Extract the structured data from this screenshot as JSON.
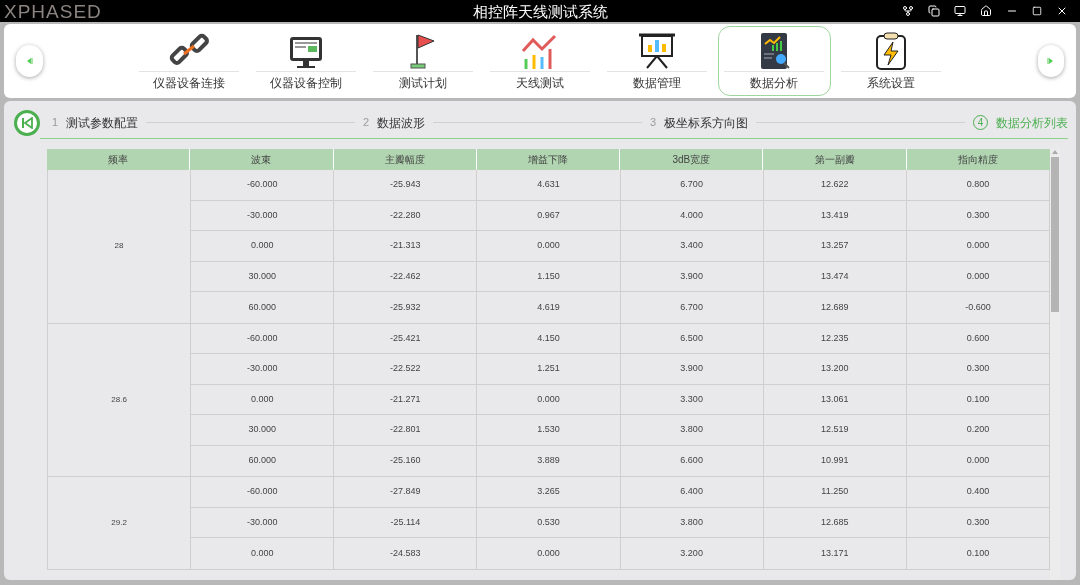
{
  "window": {
    "logo": "XPHASED",
    "title": "相控阵天线测试系统"
  },
  "nav": {
    "items": [
      {
        "label": "仪器设备连接",
        "selected": false
      },
      {
        "label": "仪器设备控制",
        "selected": false
      },
      {
        "label": "测试计划",
        "selected": false
      },
      {
        "label": "天线测试",
        "selected": false
      },
      {
        "label": "数据管理",
        "selected": false
      },
      {
        "label": "数据分析",
        "selected": true
      },
      {
        "label": "系统设置",
        "selected": false
      }
    ]
  },
  "steps": [
    {
      "number": "1",
      "label": "测试参数配置",
      "selected": false
    },
    {
      "number": "2",
      "label": "数据波形",
      "selected": false
    },
    {
      "number": "3",
      "label": "极坐标系方向图",
      "selected": false
    },
    {
      "number": "4",
      "label": "数据分析列表",
      "selected": true
    }
  ],
  "table": {
    "columns": [
      "频率",
      "波束",
      "主瓣幅度",
      "增益下降",
      "3dB宽度",
      "第一副瓣",
      "指向精度"
    ],
    "groups": [
      {
        "frequency": "28",
        "rows": [
          [
            "-60.000",
            "-25.943",
            "4.631",
            "6.700",
            "12.622",
            "0.800"
          ],
          [
            "-30.000",
            "-22.280",
            "0.967",
            "4.000",
            "13.419",
            "0.300"
          ],
          [
            "0.000",
            "-21.313",
            "0.000",
            "3.400",
            "13.257",
            "0.000"
          ],
          [
            "30.000",
            "-22.462",
            "1.150",
            "3.900",
            "13.474",
            "0.000"
          ],
          [
            "60.000",
            "-25.932",
            "4.619",
            "6.700",
            "12.689",
            "-0.600"
          ]
        ]
      },
      {
        "frequency": "28.6",
        "rows": [
          [
            "-60.000",
            "-25.421",
            "4.150",
            "6.500",
            "12.235",
            "0.600"
          ],
          [
            "-30.000",
            "-22.522",
            "1.251",
            "3.900",
            "13.200",
            "0.300"
          ],
          [
            "0.000",
            "-21.271",
            "0.000",
            "3.300",
            "13.061",
            "0.100"
          ],
          [
            "30.000",
            "-22.801",
            "1.530",
            "3.800",
            "12.519",
            "0.200"
          ],
          [
            "60.000",
            "-25.160",
            "3.889",
            "6.600",
            "10.991",
            "0.000"
          ]
        ]
      },
      {
        "frequency": "29.2",
        "rows": [
          [
            "-60.000",
            "-27.849",
            "3.265",
            "6.400",
            "11.250",
            "0.400"
          ],
          [
            "-30.000",
            "-25.114",
            "0.530",
            "3.800",
            "12.685",
            "0.300"
          ],
          [
            "0.000",
            "-24.583",
            "0.000",
            "3.200",
            "13.171",
            "0.100"
          ]
        ]
      }
    ]
  }
}
